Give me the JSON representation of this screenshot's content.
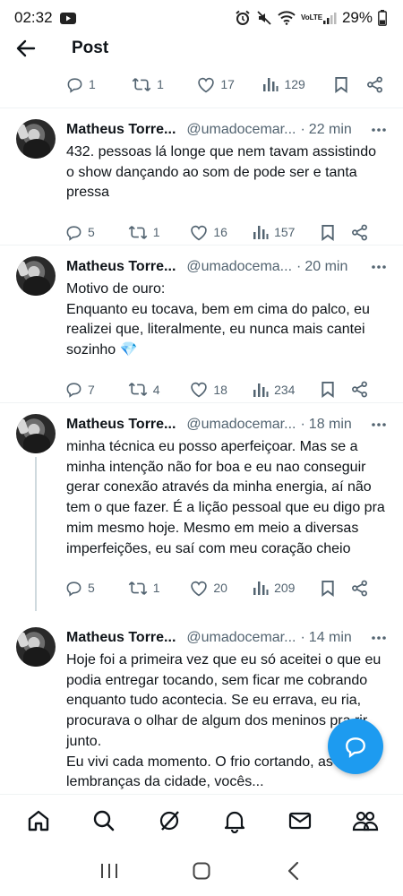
{
  "status_bar": {
    "time": "02:32",
    "battery": "29%",
    "network": "VoLTE"
  },
  "header": {
    "title": "Post"
  },
  "top_actions": {
    "replies": "1",
    "reposts": "1",
    "likes": "17",
    "views": "129"
  },
  "posts": [
    {
      "author": "Matheus Torre...",
      "handle": "@umadocemar...",
      "time": "22 min",
      "text": "432. pessoas lá longe que nem tavam assistindo o show dançando ao som de pode ser e tanta pressa",
      "replies": "5",
      "reposts": "1",
      "likes": "16",
      "views": "157"
    },
    {
      "author": "Matheus Torre...",
      "handle": "@umadocema...",
      "time": "20 min",
      "text": "Motivo de ouro:\nEnquanto eu tocava, bem em cima do palco, eu realizei que, literalmente, eu nunca mais cantei sozinho 💎",
      "replies": "7",
      "reposts": "4",
      "likes": "18",
      "views": "234"
    },
    {
      "author": "Matheus Torre...",
      "handle": "@umadocemar...",
      "time": "18 min",
      "text": "minha técnica eu posso aperfeiçoar. Mas se a minha intenção não for boa e eu nao conseguir gerar conexão através da minha energia, aí não tem o que fazer. É a lição pessoal que eu digo pra mim mesmo hoje. Mesmo em meio a diversas imperfeições, eu saí com meu coração cheio",
      "replies": "5",
      "reposts": "1",
      "likes": "20",
      "views": "209"
    },
    {
      "author": "Matheus Torre...",
      "handle": "@umadocemar...",
      "time": "14 min",
      "text": "Hoje foi a primeira vez que eu só aceitei o que eu podia entregar tocando, sem ficar me cobrando enquanto tudo acontecia. Se eu errava, eu ria, procurava o olhar de algum dos meninos pra rir junto.\nEu vivi cada momento. O frio cortando, as lembranças da cidade, vocês..."
    }
  ],
  "bottom_nav": [
    "home-icon",
    "search-icon",
    "grok-icon",
    "notifications-icon",
    "messages-icon",
    "communities-icon"
  ],
  "colors": {
    "accent": "#1d9bf0",
    "text_primary": "#0f1419",
    "text_secondary": "#536471",
    "divider": "#eff3f4"
  }
}
